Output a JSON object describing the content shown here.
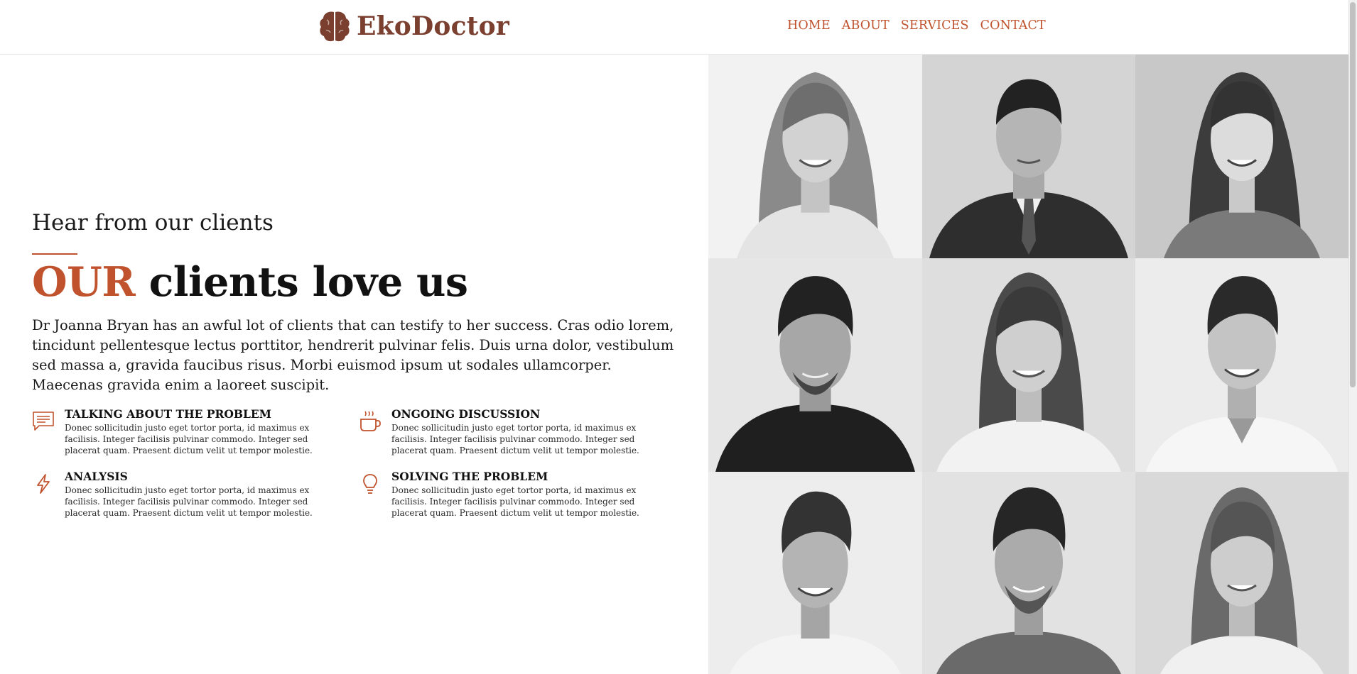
{
  "brand": {
    "name": "EkoDoctor",
    "icon": "brain-icon",
    "color": "#7a3f2e"
  },
  "nav": {
    "items": [
      {
        "label": "HOME"
      },
      {
        "label": "ABOUT"
      },
      {
        "label": "SERVICES"
      },
      {
        "label": "CONTACT"
      }
    ]
  },
  "hero": {
    "subtitle": "Hear from our clients",
    "headline_accent": "OUR",
    "headline_rest": " clients love us",
    "intro": "Dr Joanna Bryan has an awful lot of clients that can testify to her success. Cras odio lorem, tincidunt pellentesque lectus porttitor, hendrerit pulvinar felis. Duis urna dolor, vestibulum sed massa a, gravida faucibus risus. Morbi euismod ipsum ut sodales ullamcorper. Maecenas gravida enim a laoreet suscipit."
  },
  "features": [
    {
      "icon": "chat-icon",
      "title": "TALKING ABOUT THE PROBLEM",
      "text": "Donec sollicitudin justo eget tortor porta, id maximus ex facilisis. Integer facilisis pulvinar commodo. Integer sed placerat quam. Praesent dictum velit ut tempor molestie."
    },
    {
      "icon": "coffee-cup-icon",
      "title": "ONGOING DISCUSSION",
      "text": "Donec sollicitudin justo eget tortor porta, id maximus ex facilisis. Integer facilisis pulvinar commodo. Integer sed placerat quam. Praesent dictum velit ut tempor molestie."
    },
    {
      "icon": "lightning-icon",
      "title": "ANALYSIS",
      "text": "Donec sollicitudin justo eget tortor porta, id maximus ex facilisis. Integer facilisis pulvinar commodo. Integer sed placerat quam. Praesent dictum velit ut tempor molestie."
    },
    {
      "icon": "lightbulb-icon",
      "title": "SOLVING THE PROBLEM",
      "text": "Donec sollicitudin justo eget tortor porta, id maximus ex facilisis. Integer facilisis pulvinar commodo. Integer sed placerat quam. Praesent dictum velit ut tempor molestie."
    }
  ],
  "colors": {
    "accent": "#c0532e",
    "text": "#1a1a1a"
  },
  "gallery": {
    "count": 9,
    "style": "grayscale client portraits"
  }
}
